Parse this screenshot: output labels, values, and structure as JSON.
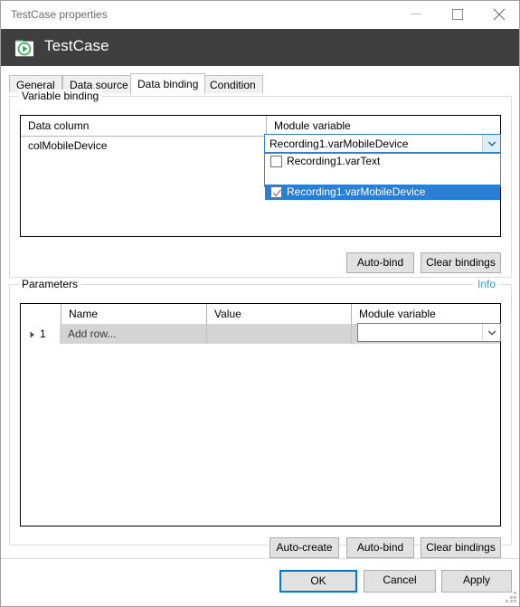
{
  "window": {
    "title": "TestCase properties",
    "minimize_tooltip": "Minimize",
    "maximize_tooltip": "Maximize",
    "close_tooltip": "Close"
  },
  "header": {
    "title": "TestCase",
    "icon": "testcase-folder-play-icon",
    "icon_color": "#35a853",
    "background": "#3f3f3f"
  },
  "tabs": [
    {
      "label": "General",
      "active": false
    },
    {
      "label": "Data source",
      "active": false
    },
    {
      "label": "Data binding",
      "active": true
    },
    {
      "label": "Condition",
      "active": false
    }
  ],
  "variable_binding": {
    "legend": "Variable binding",
    "columns": [
      "Data column",
      "Module variable"
    ],
    "rows": [
      {
        "data_column": "colMobileDevice",
        "module_variable": "Recording1.varMobileDevice"
      }
    ],
    "dropdown": {
      "open": true,
      "selected_color": "#2a7fd4",
      "items": [
        {
          "label": "Recording1.varText",
          "checked": false,
          "selected": false
        },
        {
          "label": "Recording1.varMobileDevice",
          "checked": true,
          "selected": true
        }
      ]
    },
    "buttons": [
      {
        "label": "Auto-bind"
      },
      {
        "label": "Clear bindings"
      }
    ]
  },
  "parameters": {
    "legend": "Parameters",
    "info_link": "Info",
    "info_link_color": "#2f9bde",
    "columns": [
      "",
      "Name",
      "Value",
      "Module variable"
    ],
    "rows": [
      {
        "index": "1",
        "name": "Add row...",
        "value": "",
        "module_variable": ""
      }
    ],
    "buttons": [
      {
        "label": "Auto-create"
      },
      {
        "label": "Auto-bind"
      },
      {
        "label": "Clear bindings"
      }
    ]
  },
  "footer": {
    "buttons": [
      {
        "label": "OK",
        "primary": true
      },
      {
        "label": "Cancel",
        "primary": false
      },
      {
        "label": "Apply",
        "primary": false
      }
    ]
  }
}
